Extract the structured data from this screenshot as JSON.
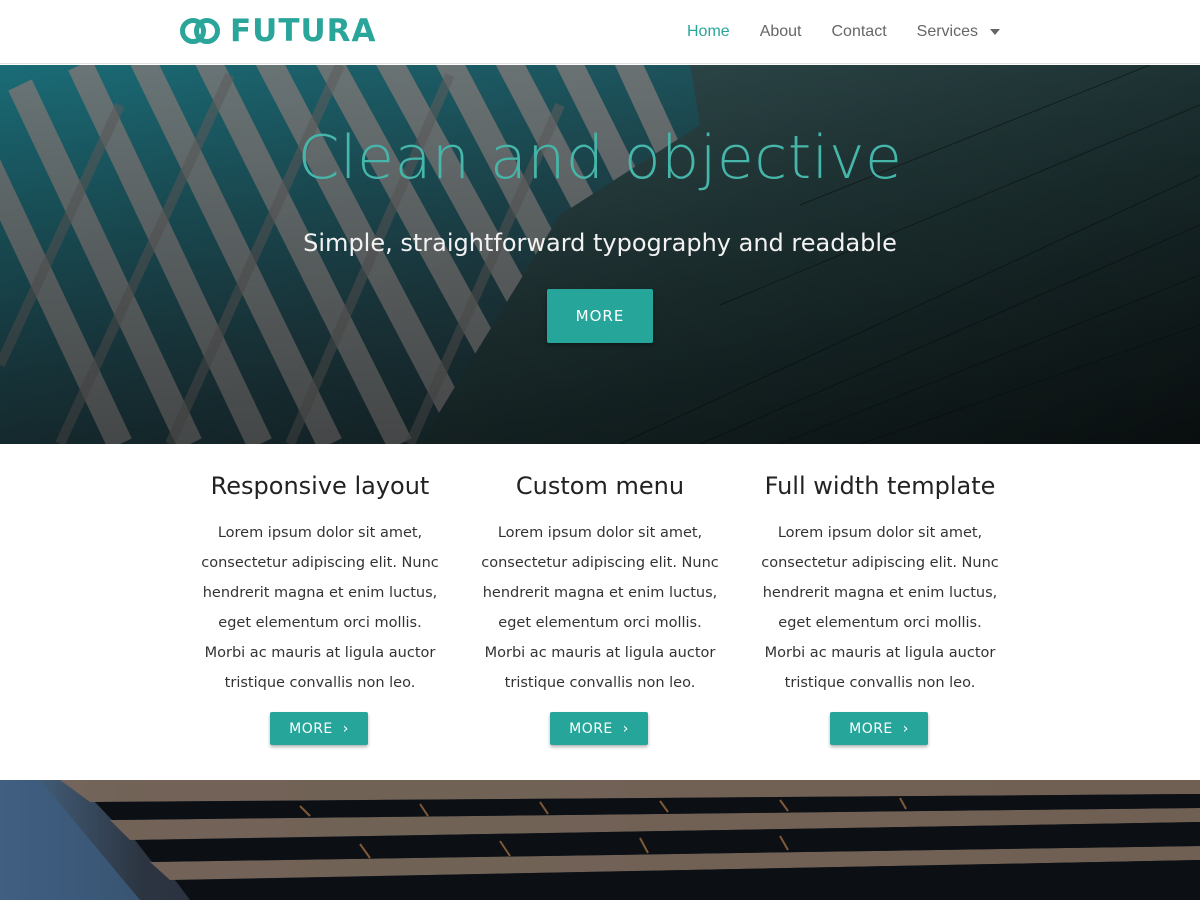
{
  "header": {
    "logo_text": "FUTURA",
    "nav": [
      {
        "label": "Home",
        "active": true
      },
      {
        "label": "About"
      },
      {
        "label": "Contact"
      },
      {
        "label": "Services",
        "has_dropdown": true
      }
    ]
  },
  "hero": {
    "title": "Clean and objective",
    "subtitle": "Simple, straightforward typography and readable",
    "button_label": "MORE"
  },
  "features": [
    {
      "title": "Responsive layout",
      "lines": [
        "Lorem ipsum dolor sit amet,",
        "consectetur adipiscing elit. Nunc",
        "hendrerit magna et enim luctus,",
        "eget elementum orci mollis.",
        "Morbi ac mauris at ligula auctor",
        "tristique convallis non leo."
      ],
      "button_label": "MORE"
    },
    {
      "title": "Custom menu",
      "lines": [
        "Lorem ipsum dolor sit amet,",
        "consectetur adipiscing elit. Nunc",
        "hendrerit magna et enim luctus,",
        "eget elementum orci mollis.",
        "Morbi ac mauris at ligula auctor",
        "tristique convallis non leo."
      ],
      "button_label": "MORE"
    },
    {
      "title": "Full width template",
      "lines": [
        "Lorem ipsum dolor sit amet,",
        "consectetur adipiscing elit. Nunc",
        "hendrerit magna et enim luctus,",
        "eget elementum orci mollis.",
        "Morbi ac mauris at ligula auctor",
        "tristique convallis non leo."
      ],
      "button_label": "MORE"
    }
  ],
  "icons": {
    "logo": "overlapping-rings-icon",
    "dropdown": "caret-down-icon",
    "button_arrow": "chevron-right-icon"
  },
  "colors": {
    "accent": "#26a69a",
    "hero_title": "#46b6aa",
    "nav_text": "#666666",
    "body_text": "#333333"
  }
}
